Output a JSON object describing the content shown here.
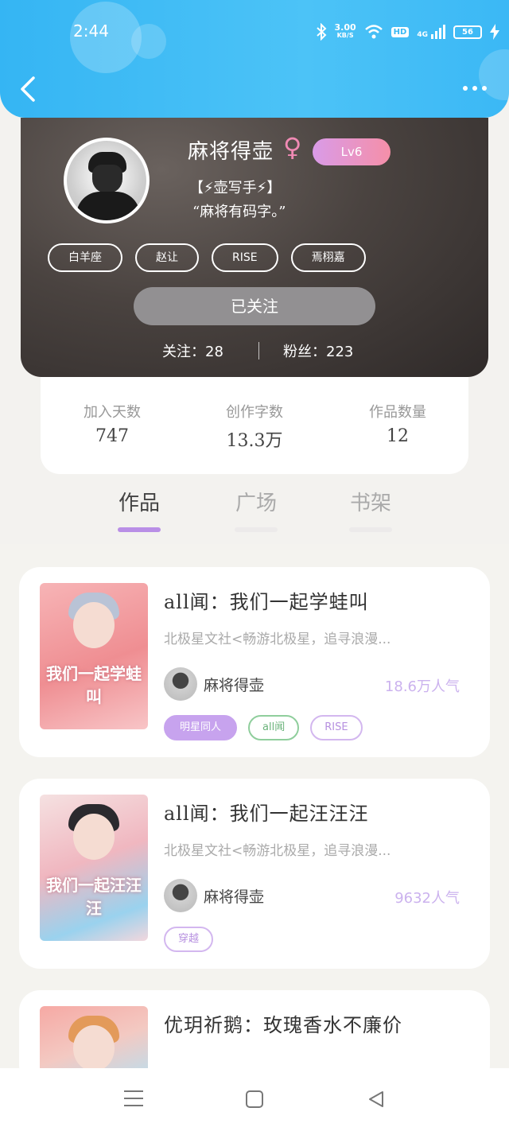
{
  "status_bar": {
    "time": "2:44",
    "speed_value": "3.00",
    "speed_unit": "KB/S",
    "hd": "HD",
    "network": "4G",
    "battery": "56"
  },
  "header": {
    "back_icon": "chevron-left-icon",
    "more_icon": "ellipsis-icon",
    "color": "#3bb8f5"
  },
  "profile": {
    "username": "麻将得壶",
    "gender_symbol": "♀",
    "level": "Lv6",
    "title_tag": "【⚡壶写手⚡】",
    "signature": "“麻将有码字。”",
    "tags": [
      "白羊座",
      "赵让",
      "RISE",
      "焉栩嘉"
    ],
    "follow_button": "已关注",
    "following_label": "关注：28",
    "fans_label": "粉丝：223"
  },
  "stats": [
    {
      "label": "加入天数",
      "value": "747"
    },
    {
      "label": "创作字数",
      "value": "13.3万"
    },
    {
      "label": "作品数量",
      "value": "12"
    }
  ],
  "tabs": [
    {
      "label": "作品",
      "active": true
    },
    {
      "label": "广场",
      "active": false
    },
    {
      "label": "书架",
      "active": false
    }
  ],
  "works": [
    {
      "title": "all闻：我们一起学蛙叫",
      "description": "北极星文社<畅游北极星，追寻浪漫...",
      "author": "麻将得壶",
      "popularity": "18.6万人气",
      "cover_text": "我们一起学蛙叫",
      "tags": [
        "明星同人",
        "all闻",
        "RISE"
      ]
    },
    {
      "title": "all闻：我们一起汪汪汪",
      "description": "北极星文社<畅游北极星，追寻浪漫...",
      "author": "麻将得壶",
      "popularity": "9632人气",
      "cover_text": "我们一起汪汪汪",
      "tags": [
        "穿越"
      ]
    },
    {
      "title": "优玥祈鹅：玫瑰香水不廉价"
    }
  ],
  "colors": {
    "accent_purple": "#b98fe6",
    "popularity_text": "#cbb2ee",
    "tag_filled": "#c7a3ee",
    "tag_green": "#8fce9c"
  },
  "navbar": {
    "menu_icon": "menu-icon",
    "home_icon": "home-square-icon",
    "back_icon": "back-triangle-icon"
  }
}
